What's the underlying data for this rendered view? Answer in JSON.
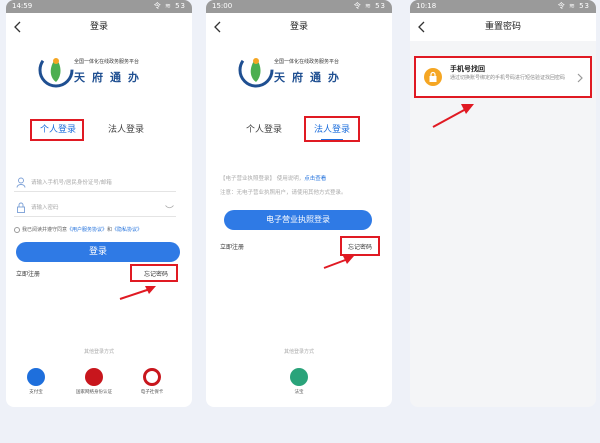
{
  "screens": [
    {
      "status_time": "14:59",
      "status_icons": "令 ≋ 53",
      "nav_title": "登录",
      "logo_subtitle": "全国一体化在线政务服务平台",
      "logo_brand": "天府通办",
      "tab_personal": "个人登录",
      "tab_corporate": "法人登录",
      "phone_placeholder": "请输入手机号/居民身份证号/邮箱",
      "password_placeholder": "请输入密码",
      "agree_prefix": "我已阅读并遵守同意",
      "agree_link1": "《用户服务协议》",
      "agree_mid": "和",
      "agree_link2": "《隐私协议》",
      "login_button": "登录",
      "register_link": "立即注册",
      "forgot_link": "忘记密码",
      "other_title": "其他登录方式",
      "alt_logins": [
        {
          "label": "支付宝",
          "icon": "alipay-icon",
          "color": "#1e6fdc"
        },
        {
          "label": "国家网络身份认证",
          "icon": "national-id-icon",
          "color": "#c8161d"
        },
        {
          "label": "电子社保卡",
          "icon": "social-security-card-icon",
          "color": "#c8161d"
        }
      ]
    },
    {
      "status_time": "15:00",
      "status_icons": "令 ≋ 53",
      "nav_title": "登录",
      "logo_subtitle": "全国一体化在线政务服务平台",
      "logo_brand": "天府通办",
      "tab_personal": "个人登录",
      "tab_corporate": "法人登录",
      "notice_text": "【电子营业执照登录】 使用说明，",
      "notice_link": "点击查看",
      "notice_text2": "注意：无电子营业执照用户，请使用其他方式登录。",
      "license_button": "电子营业执照登录",
      "register_link": "立即注册",
      "forgot_link": "忘记密码",
      "other_title": "其他登录方式",
      "alt_logins": [
        {
          "label": "法宝",
          "icon": "fabao-icon",
          "color": "#2aa37a"
        }
      ]
    },
    {
      "status_time": "10:18",
      "status_icons": "令 ≋ 53",
      "nav_title": "重置密码",
      "option_title": "手机号找回",
      "option_desc": "通过切换账号绑定的手机号码进行短信验证找回密码"
    }
  ],
  "colors": {
    "accent": "#2f7ae5",
    "highlight": "#e01a23",
    "lock_badge": "#f5a623"
  }
}
